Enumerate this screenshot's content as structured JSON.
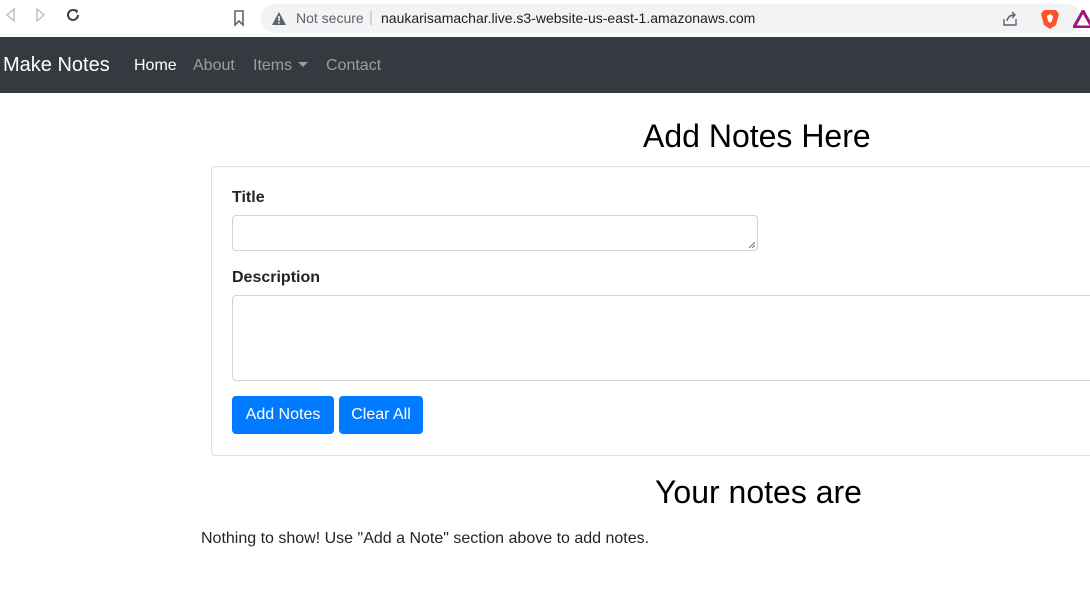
{
  "browser": {
    "security_label": "Not secure",
    "url": "naukarisamachar.live.s3-website-us-east-1.amazonaws.com",
    "icons": [
      "back-icon",
      "forward-icon",
      "reload-icon",
      "bookmark-icon",
      "warning-icon",
      "share-icon",
      "brave-shields-icon",
      "brave-rewards-icon"
    ]
  },
  "navbar": {
    "brand": "Make Notes",
    "links": [
      {
        "label": "Home",
        "active": true
      },
      {
        "label": "About"
      },
      {
        "label": "Items"
      },
      {
        "label": "Contact"
      }
    ],
    "colors": {
      "background": "#343a40"
    }
  },
  "form": {
    "heading": "Add Notes Here",
    "title_label": "Title",
    "title_value": "",
    "description_label": "Description",
    "description_value": "",
    "add_button": "Add Notes",
    "clear_button": "Clear All"
  },
  "notes": {
    "heading": "Your notes are",
    "empty_message": "Nothing to show! Use \"Add a Note\" section above to add notes."
  },
  "colors": {
    "primary": "#007bff"
  }
}
